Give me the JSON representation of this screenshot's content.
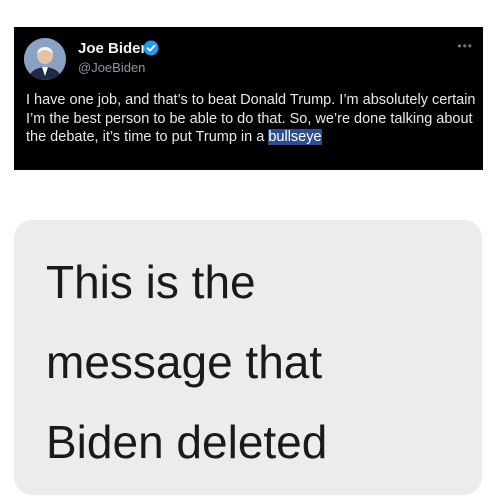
{
  "tweet": {
    "name": "Joe Biden",
    "handle": "@JoeBiden",
    "more_icon": "ellipsis-icon",
    "verified_icon": "verified-badge-icon",
    "text_main": "I have one job, and that’s to beat Donald Trump. I’m absolutely certain I’m the best person to be able to do that. So, we’re done talking about the debate, it’s time to put Trump in a ",
    "text_highlight": "bullseye",
    "colors": {
      "background": "#000000",
      "verified": "#1d9bf0",
      "highlight": "#2b4f8f"
    }
  },
  "message": {
    "lines": [
      "This is the",
      "message that",
      "Biden deleted"
    ],
    "bubble_color": "#ececec"
  }
}
